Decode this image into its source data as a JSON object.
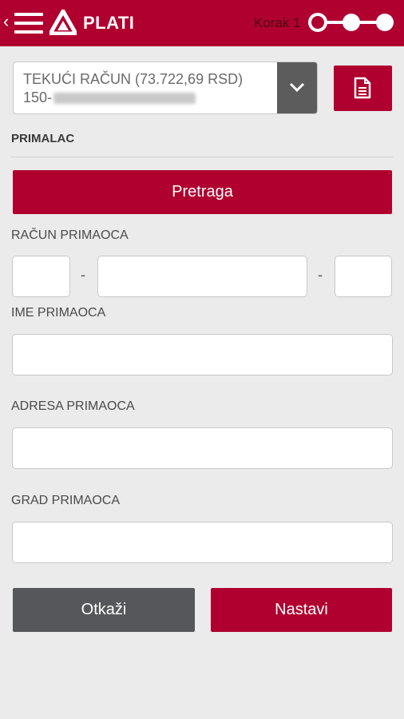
{
  "header": {
    "back_icon": "chevron-left-icon",
    "menu_icon": "hamburger-icon",
    "logo": "bank-logo",
    "title": "PLATI",
    "step_label": "Korak 1",
    "steps_total": 3,
    "steps_current": 1
  },
  "account": {
    "line1": "TEKUĆI RAČUN (73.722,69 RSD)",
    "line2_prefix": "150-",
    "dropdown_icon": "chevron-down-icon",
    "document_icon": "document-icon"
  },
  "recipient": {
    "section_title": "PRIMALAC",
    "search_label": "Pretraga",
    "account_label": "RAČUN PRIMAOCA",
    "separator": "-",
    "name_label": "IME PRIMAOCA",
    "address_label": "ADRESA PRIMAOCA",
    "city_label": "GRAD PRIMAOCA"
  },
  "actions": {
    "cancel_label": "Otkaži",
    "continue_label": "Nastavi"
  },
  "colors": {
    "brand_red": "#b0002f",
    "dark_gray": "#55575a",
    "background": "#ebebeb"
  }
}
